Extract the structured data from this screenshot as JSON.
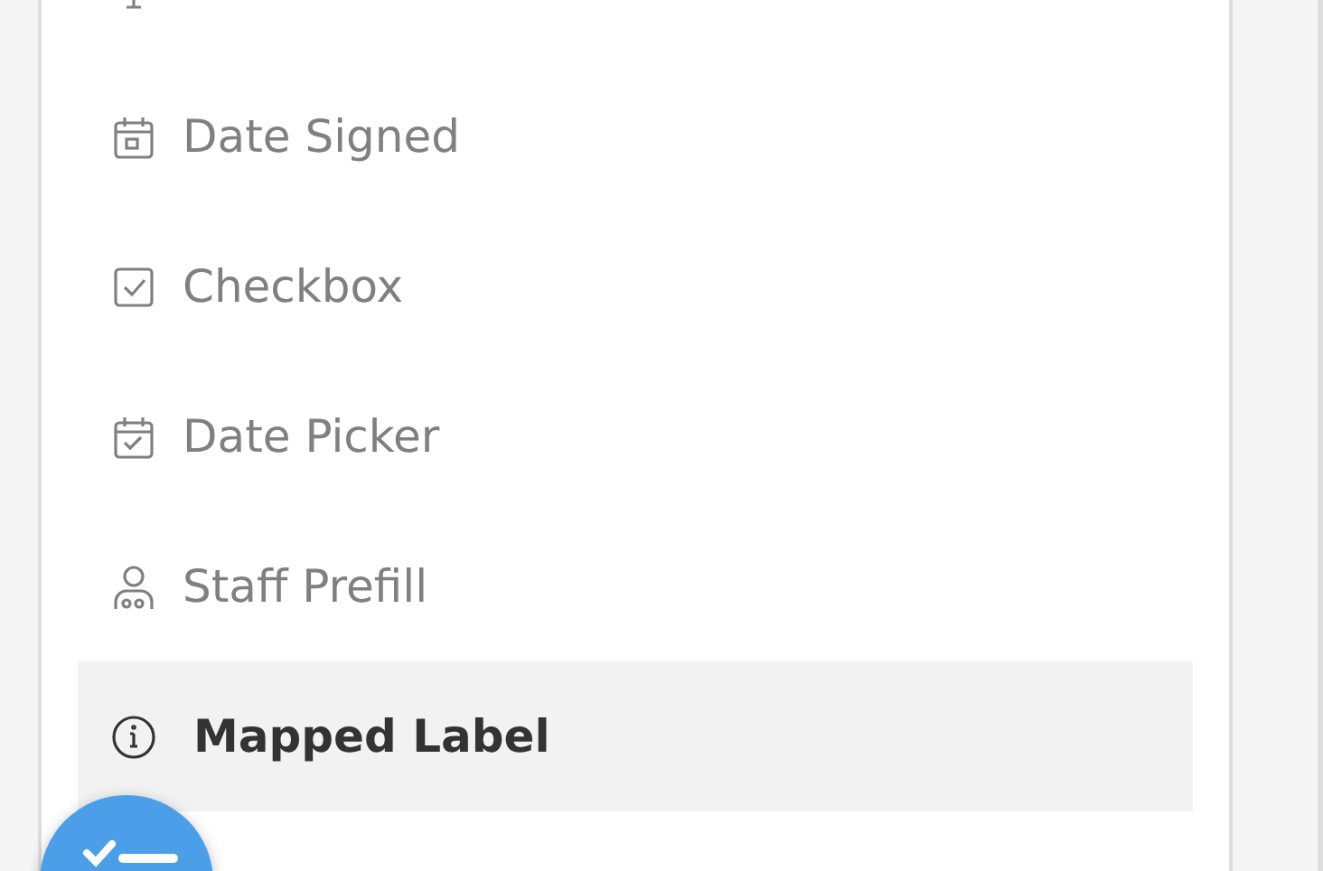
{
  "fields": [
    {
      "kind": "textbox",
      "selected": false
    },
    {
      "kind": "date-signed",
      "label": "Date Signed",
      "selected": false
    },
    {
      "kind": "checkbox",
      "label": "Checkbox",
      "selected": false
    },
    {
      "kind": "date-picker",
      "label": "Date Picker",
      "selected": false
    },
    {
      "kind": "staff",
      "label": "Staff Prefill",
      "selected": false
    },
    {
      "kind": "mapped-label",
      "label": "Mapped Label",
      "selected": true
    }
  ]
}
